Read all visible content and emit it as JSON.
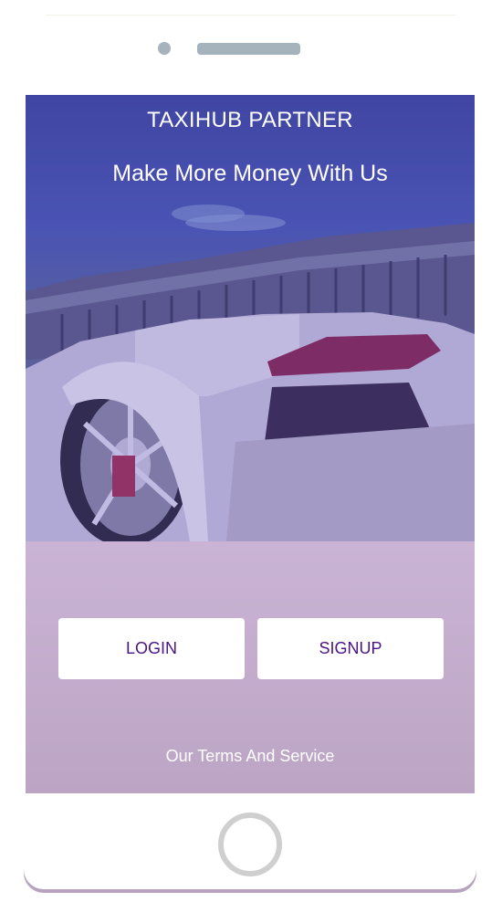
{
  "app": {
    "title": "TAXIHUB PARTNER",
    "tagline": "Make More Money With Us"
  },
  "actions": {
    "login_label": "LOGIN",
    "signup_label": "SIGNUP"
  },
  "footer": {
    "terms_label": "Our Terms And Service"
  },
  "colors": {
    "brand_purple": "#4a1486",
    "hero_overlay": "#4b5cb6",
    "lower_gradient_top": "#e3cdef",
    "lower_gradient_bottom": "#bca5c4"
  },
  "icons": {
    "camera": "camera-dot-icon",
    "speaker": "speaker-grille-icon",
    "home": "home-button-icon"
  }
}
